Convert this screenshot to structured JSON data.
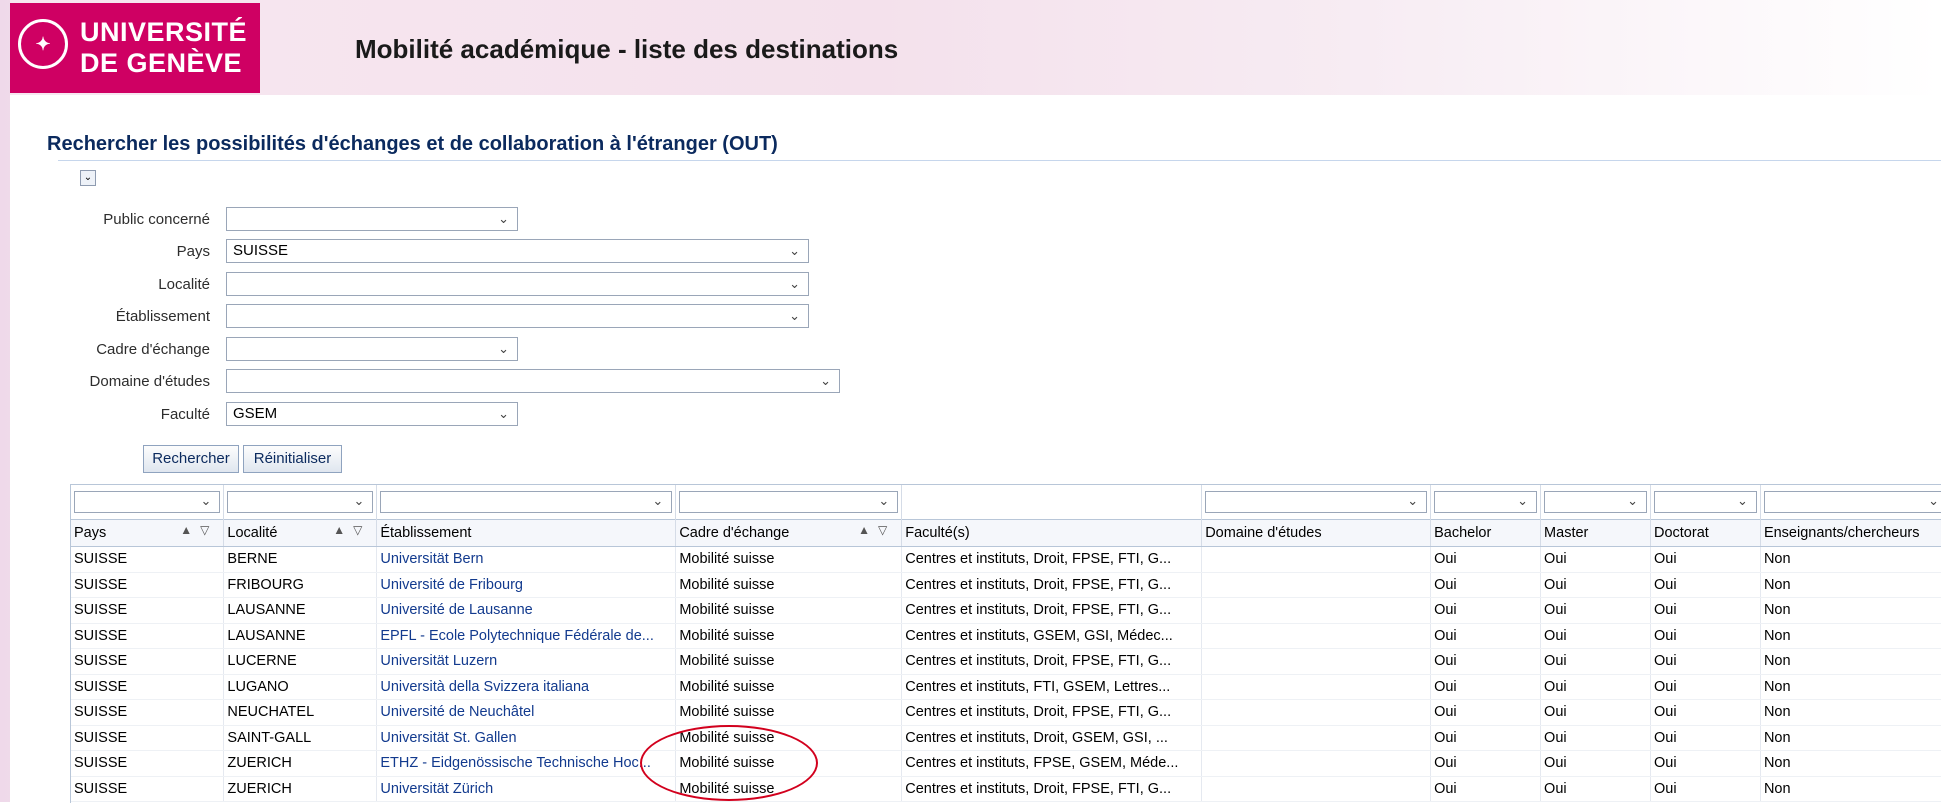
{
  "header": {
    "logo_line1": "UNIVERSITÉ",
    "logo_line2": "DE GENÈVE",
    "app_title": "Mobilité académique - liste des destinations"
  },
  "search": {
    "section_title": "Rechercher les possibilités d'échanges et de collaboration à l'étranger (OUT)",
    "fields": [
      {
        "label": "Public concerné",
        "value": ""
      },
      {
        "label": "Pays",
        "value": "SUISSE"
      },
      {
        "label": "Localité",
        "value": ""
      },
      {
        "label": "Établissement",
        "value": ""
      },
      {
        "label": "Cadre d'échange",
        "value": ""
      },
      {
        "label": "Domaine d'études",
        "value": ""
      },
      {
        "label": "Faculté",
        "value": "GSEM"
      }
    ],
    "search_button": "Rechercher",
    "reset_button": "Réinitialiser"
  },
  "table": {
    "columns": [
      "Pays",
      "Localité",
      "Établissement",
      "Cadre d'échange",
      "Faculté(s)",
      "Domaine d'études",
      "Bachelor",
      "Master",
      "Doctorat",
      "Enseignants/chercheurs"
    ],
    "rows": [
      [
        "SUISSE",
        "BERNE",
        "Universität Bern",
        "Mobilité suisse",
        "Centres et instituts, Droit, FPSE, FTI, G...",
        "",
        "Oui",
        "Oui",
        "Oui",
        "Non"
      ],
      [
        "SUISSE",
        "FRIBOURG",
        "Université de Fribourg",
        "Mobilité suisse",
        "Centres et instituts, Droit, FPSE, FTI, G...",
        "",
        "Oui",
        "Oui",
        "Oui",
        "Non"
      ],
      [
        "SUISSE",
        "LAUSANNE",
        "Université de Lausanne",
        "Mobilité suisse",
        "Centres et instituts, Droit, FPSE, FTI, G...",
        "",
        "Oui",
        "Oui",
        "Oui",
        "Non"
      ],
      [
        "SUISSE",
        "LAUSANNE",
        "EPFL - Ecole Polytechnique Fédérale de...",
        "Mobilité suisse",
        "Centres et instituts, GSEM, GSI, Médec...",
        "",
        "Oui",
        "Oui",
        "Oui",
        "Non"
      ],
      [
        "SUISSE",
        "LUCERNE",
        "Universität Luzern",
        "Mobilité suisse",
        "Centres et instituts, Droit, FPSE, FTI, G...",
        "",
        "Oui",
        "Oui",
        "Oui",
        "Non"
      ],
      [
        "SUISSE",
        "LUGANO",
        "Università della Svizzera italiana",
        "Mobilité suisse",
        "Centres et instituts, FTI, GSEM, Lettres...",
        "",
        "Oui",
        "Oui",
        "Oui",
        "Non"
      ],
      [
        "SUISSE",
        "NEUCHATEL",
        "Université de Neuchâtel",
        "Mobilité suisse",
        "Centres et instituts, Droit, FPSE, FTI, G...",
        "",
        "Oui",
        "Oui",
        "Oui",
        "Non"
      ],
      [
        "SUISSE",
        "SAINT-GALL",
        "Universität St. Gallen",
        "Mobilité suisse",
        "Centres et instituts, Droit, GSEM, GSI, ...",
        "",
        "Oui",
        "Oui",
        "Oui",
        "Non"
      ],
      [
        "SUISSE",
        "ZUERICH",
        "ETHZ - Eidgenössische Technische Hoc...",
        "Mobilité suisse",
        "Centres et instituts, FPSE, GSEM, Méde...",
        "",
        "Oui",
        "Oui",
        "Oui",
        "Non"
      ],
      [
        "SUISSE",
        "ZUERICH",
        "Universität Zürich",
        "Mobilité suisse",
        "Centres et instituts, Droit, FPSE, FTI, G...",
        "",
        "Oui",
        "Oui",
        "Oui",
        "Non"
      ]
    ]
  },
  "colors": {
    "brand": "#cf0063",
    "link": "#123a8e",
    "annotation": "#d2001d"
  }
}
